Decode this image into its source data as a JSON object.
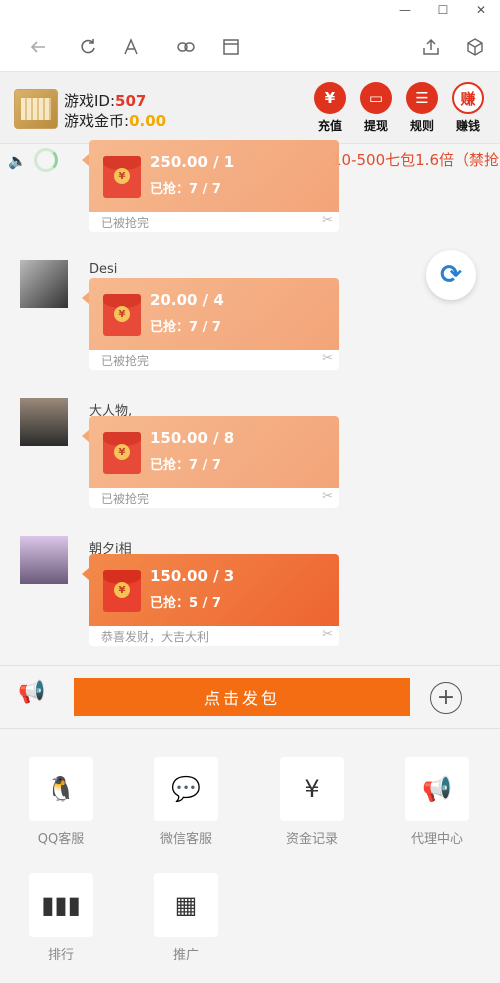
{
  "window": {
    "minimize": "—",
    "maximize": "☐",
    "close": "✕"
  },
  "browser": {
    "icons": [
      "back-icon",
      "refresh-icon",
      "font-icon",
      "link-icon",
      "window-icon",
      "share-icon",
      "cube-icon"
    ]
  },
  "header": {
    "game_id_label": "游戏ID:",
    "game_id_value": "507",
    "coin_label": "游戏金币:",
    "coin_value": "0.00",
    "buttons": [
      {
        "label": "充值",
        "glyph": "¥"
      },
      {
        "label": "提现",
        "glyph": "▭"
      },
      {
        "label": "规则",
        "glyph": "☰"
      },
      {
        "label": "赚钱",
        "glyph": "赚"
      }
    ]
  },
  "notice": {
    "text": "10-500七包1.6倍（禁抢"
  },
  "messages": [
    {
      "name": "",
      "amount": "250.00 / 1",
      "grabbed": "已抢：7 / 7",
      "footer": "已被抢完",
      "state": "pale"
    },
    {
      "name": "Desi",
      "amount": "20.00 / 4",
      "grabbed": "已抢：7 / 7",
      "footer": "已被抢完",
      "state": "pale"
    },
    {
      "name": "大人物,",
      "amount": "150.00 / 8",
      "grabbed": "已抢：7 / 7",
      "footer": "已被抢完",
      "state": "pale"
    },
    {
      "name": "朝夕i相",
      "amount": "150.00 / 3",
      "grabbed": "已抢：5 / 7",
      "footer": "恭喜发财，大吉大利",
      "state": "active"
    }
  ],
  "send": {
    "label": "点击发包"
  },
  "grid": [
    {
      "label": "QQ客服",
      "icon": "qq-icon",
      "glyph": "🐧"
    },
    {
      "label": "微信客服",
      "icon": "wechat-icon",
      "glyph": "💬"
    },
    {
      "label": "资金记录",
      "icon": "fund-record-icon",
      "glyph": "¥"
    },
    {
      "label": "代理中心",
      "icon": "megaphone-icon",
      "glyph": "📢"
    },
    {
      "label": "排行",
      "icon": "ranking-icon",
      "glyph": "▮▮▮"
    },
    {
      "label": "推广",
      "icon": "qrcode-icon",
      "glyph": "▦"
    }
  ],
  "colors": {
    "accent": "#f46d12",
    "red": "#e0331e",
    "coin": "#f2a900"
  }
}
